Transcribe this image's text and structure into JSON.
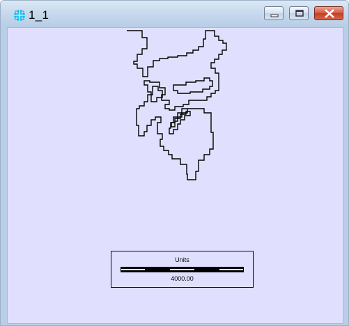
{
  "window": {
    "title": "1_1",
    "icon": "layer-grid-icon",
    "controls": {
      "minimize": "minimize-icon",
      "maximize": "maximize-icon",
      "close": "close-icon"
    }
  },
  "colors": {
    "map_background": "#e0e0fe",
    "outline": "#000000",
    "close_button": "#c94a30",
    "icon": "#2ec6f0"
  },
  "scalebar": {
    "title": "Units",
    "value": "4000.00"
  }
}
